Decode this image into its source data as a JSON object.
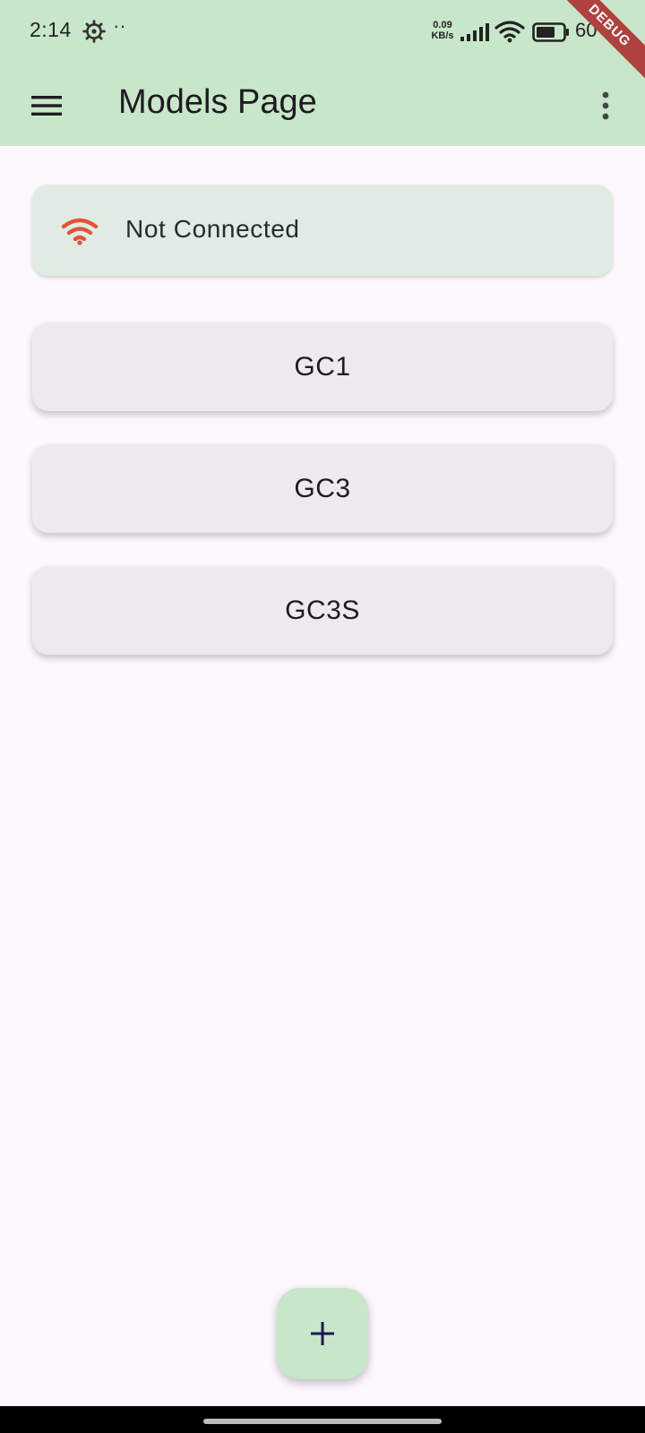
{
  "status_bar": {
    "time": "2:14",
    "dots": "··",
    "speed_value": "0.09",
    "speed_unit": "KB/s",
    "battery_text": "60"
  },
  "debug_banner": "DEBUG",
  "app_bar": {
    "title": "Models Page"
  },
  "connection": {
    "status": "Not Connected",
    "icon": "wifi-icon",
    "icon_color": "#e8503a"
  },
  "models": [
    {
      "label": "GC1"
    },
    {
      "label": "GC3"
    },
    {
      "label": "GC3S"
    }
  ],
  "fab": {
    "icon": "plus-icon",
    "color": "#c8e6c9"
  },
  "colors": {
    "app_bar": "#c8e6c9",
    "background": "#fdf8fd",
    "model_card": "#ece9f1",
    "connection_card": "#e0ece3"
  }
}
